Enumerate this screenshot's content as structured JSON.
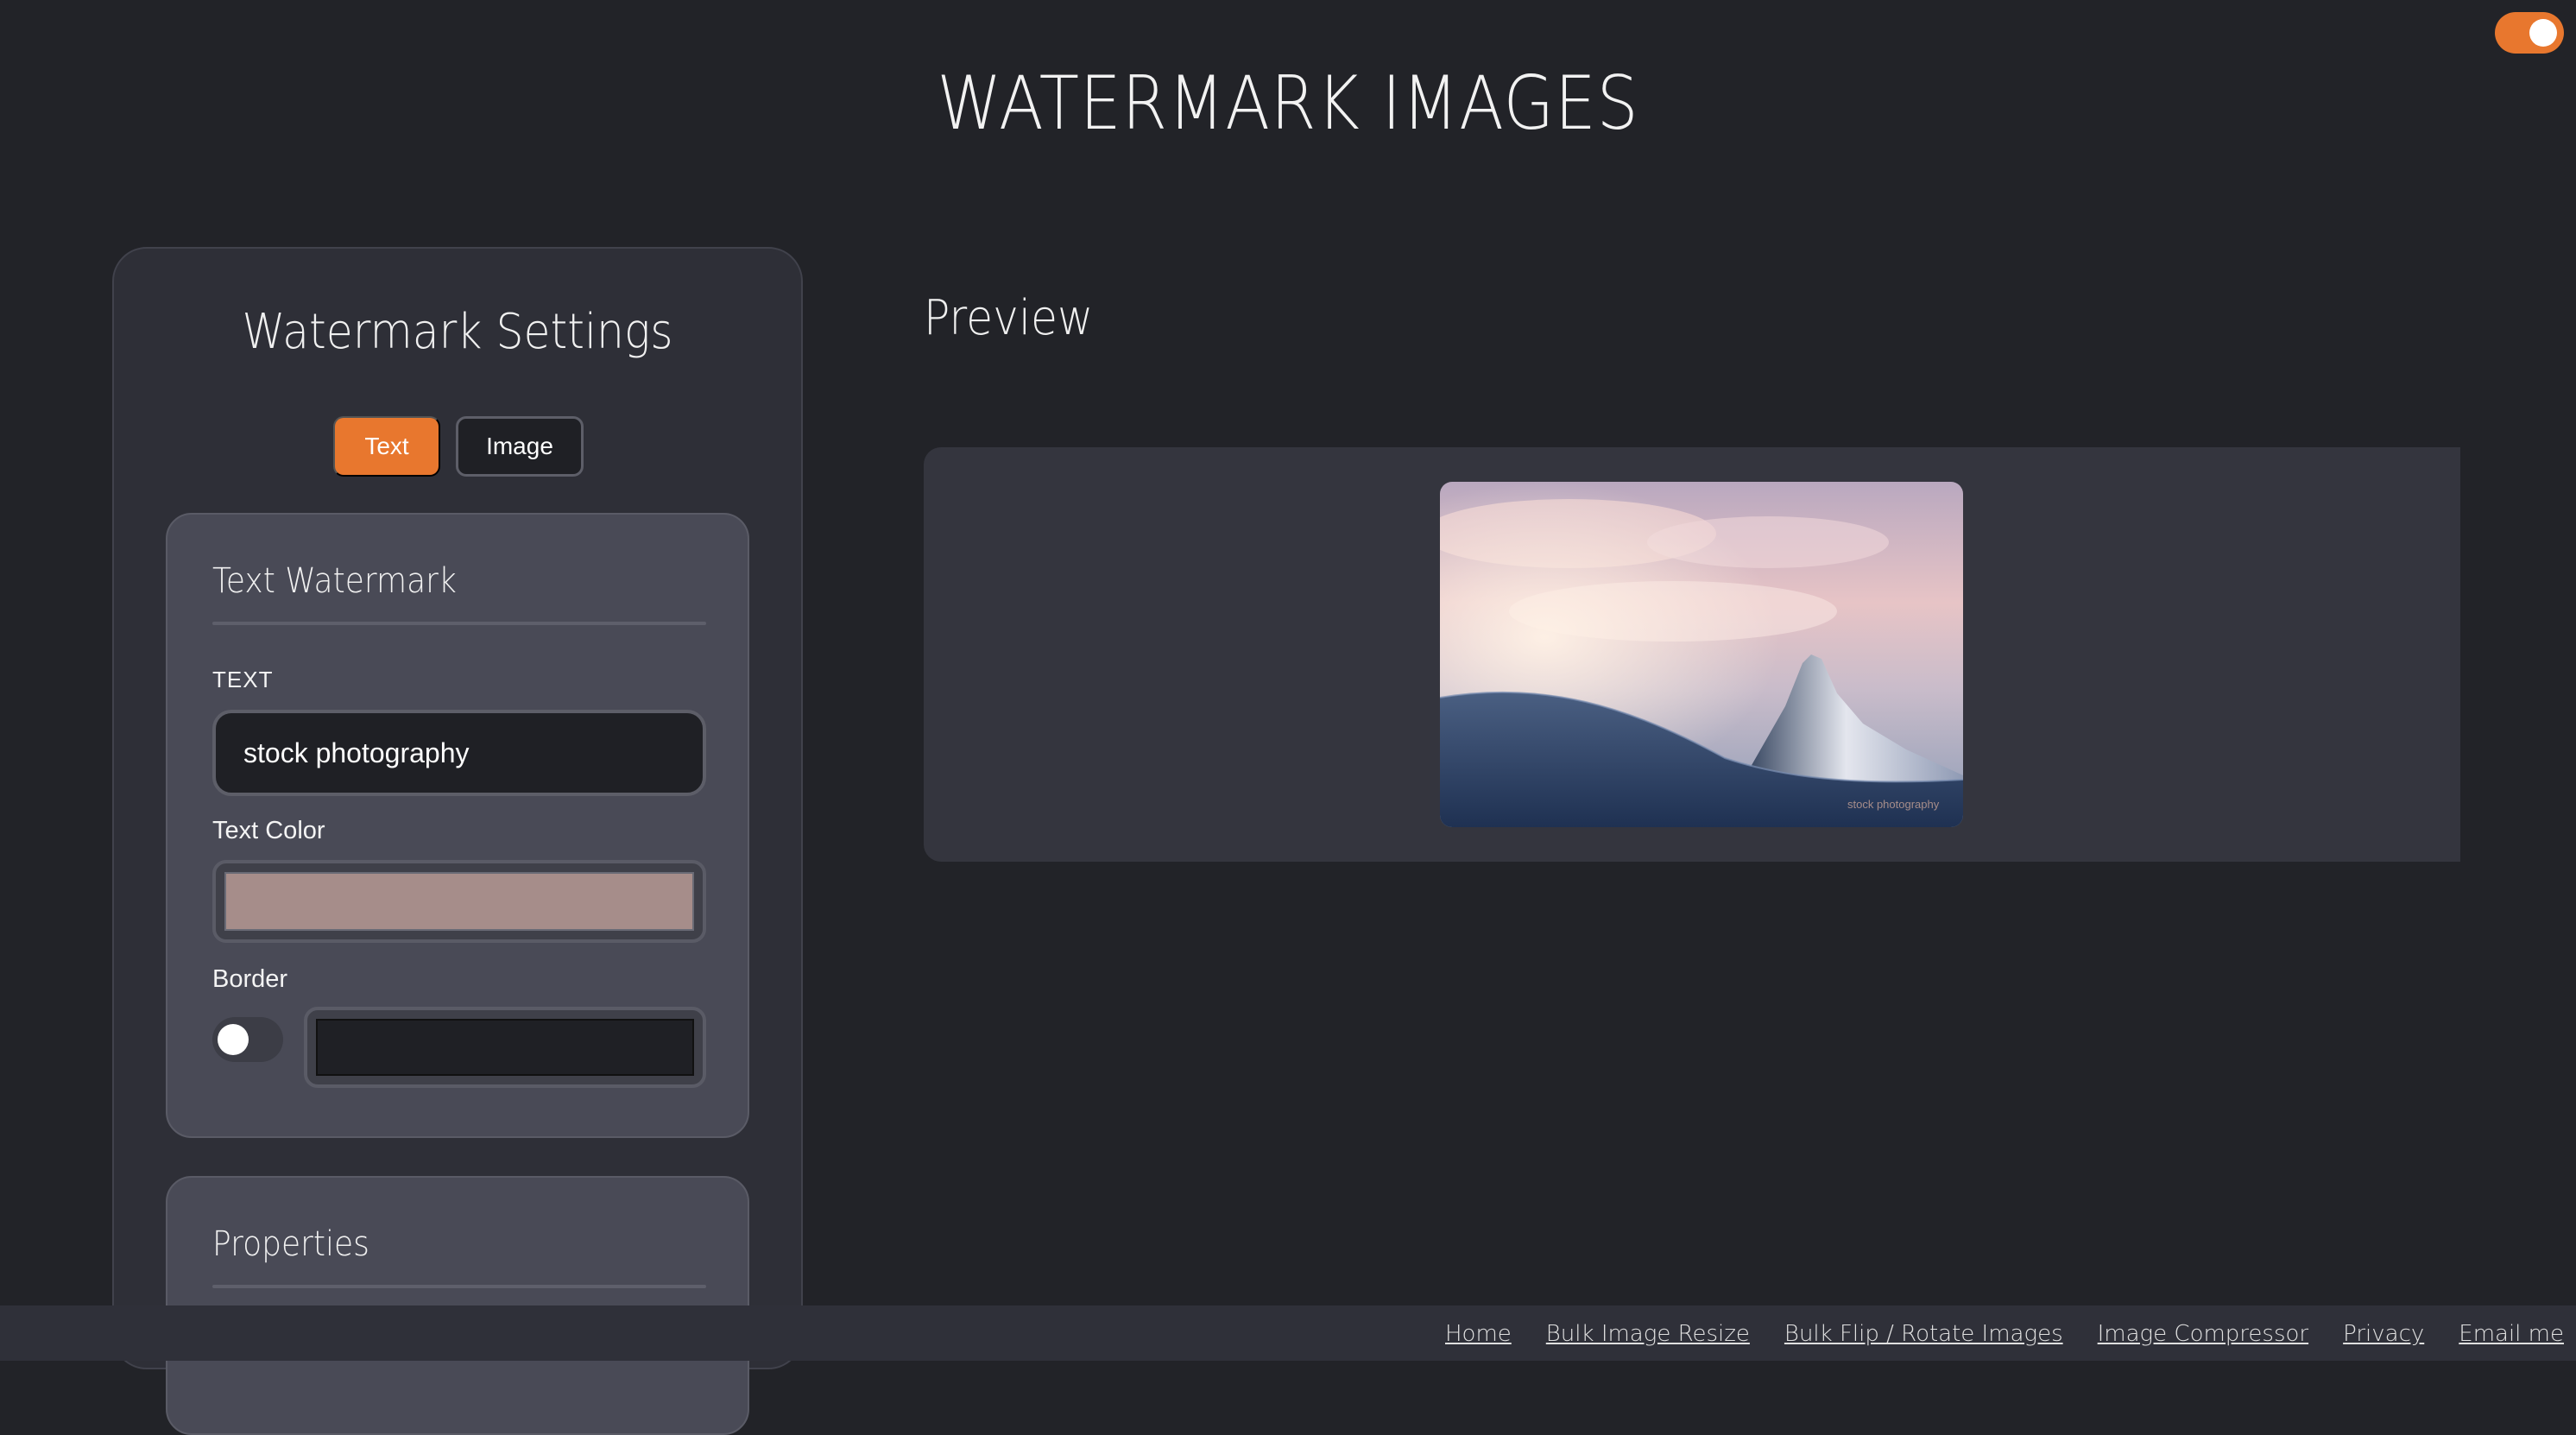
{
  "header": {
    "title": "WATERMARK IMAGES",
    "theme_toggle_on": true
  },
  "settings": {
    "title": "Watermark Settings",
    "tabs": [
      {
        "label": "Text",
        "active": true
      },
      {
        "label": "Image",
        "active": false
      }
    ],
    "text_watermark": {
      "heading": "Text Watermark",
      "text_label": "TEXT",
      "text_value": "stock photography",
      "color_label": "Text Color",
      "color_value": "#a68d8a",
      "border_label": "Border",
      "border_enabled": false,
      "border_color": "#1f2025"
    },
    "properties": {
      "heading": "Properties"
    }
  },
  "preview": {
    "title": "Preview",
    "watermark_text": "stock photography",
    "image_subject": "mountain-peak-photo"
  },
  "footer": {
    "links": [
      "Home",
      "Bulk Image Resize",
      "Bulk Flip / Rotate Images",
      "Image Compressor",
      "Privacy",
      "Email me"
    ]
  },
  "colors": {
    "accent": "#e8772e",
    "background": "#222328",
    "panel": "#2e2f37",
    "card": "#494a56"
  }
}
